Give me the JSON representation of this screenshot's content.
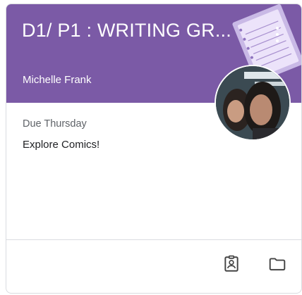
{
  "class_card": {
    "title": "D1/ P1 : WRITING GR...",
    "teacher": "Michelle Frank",
    "header_color": "#7b5aa6",
    "due": {
      "label": "Due Thursday",
      "assignment": "Explore Comics!"
    },
    "footer_icons": [
      "assignment-ind-icon",
      "folder-icon"
    ],
    "header_icons": [
      "more-vert-icon"
    ]
  }
}
